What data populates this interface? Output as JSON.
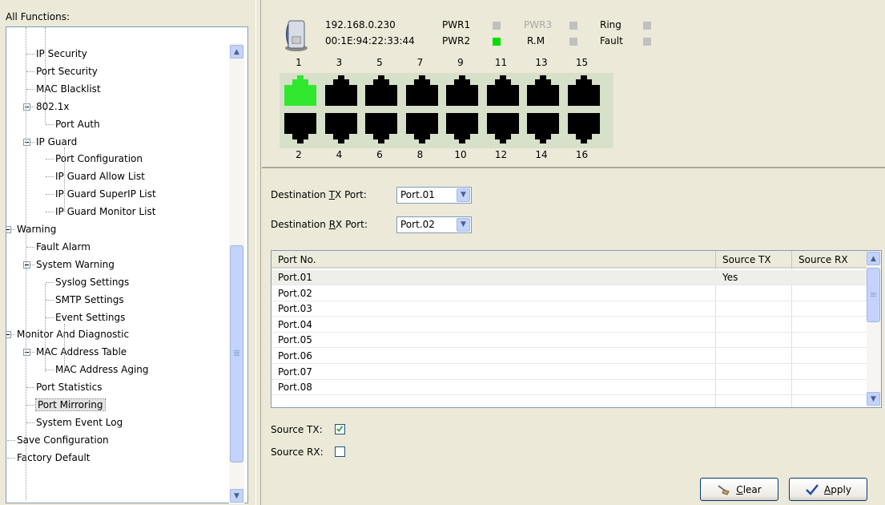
{
  "sidebar": {
    "heading": "All Functions:",
    "items": [
      {
        "label": "IP Security"
      },
      {
        "label": "Port Security"
      },
      {
        "label": "MAC Blacklist"
      },
      {
        "label": "802.1x"
      },
      {
        "label": "Port Auth"
      },
      {
        "label": "IP Guard"
      },
      {
        "label": "Port Configuration"
      },
      {
        "label": "IP Guard Allow List"
      },
      {
        "label": "IP Guard SuperIP List"
      },
      {
        "label": "IP Guard Monitor List"
      },
      {
        "label": "Warning"
      },
      {
        "label": "Fault Alarm"
      },
      {
        "label": "System Warning"
      },
      {
        "label": "Syslog Settings"
      },
      {
        "label": "SMTP Settings"
      },
      {
        "label": "Event Settings"
      },
      {
        "label": "Monitor And Diagnostic"
      },
      {
        "label": "MAC Address Table"
      },
      {
        "label": "MAC Address Aging"
      },
      {
        "label": "Port Statistics"
      },
      {
        "label": "Port Mirroring"
      },
      {
        "label": "System Event Log"
      },
      {
        "label": "Save Configuration"
      },
      {
        "label": "Factory Default"
      }
    ],
    "selected": "Port Mirroring"
  },
  "device": {
    "ip": "192.168.0.230",
    "mac": "00:1E:94:22:33:44",
    "indicators": {
      "pwr1": {
        "label": "PWR1",
        "color": "#c0c0c0"
      },
      "pwr2": {
        "label": "PWR2",
        "color": "#00e000"
      },
      "pwr3": {
        "label": "PWR3",
        "color": "#c0c0c0"
      },
      "rm": {
        "label": "R.M",
        "color": "#c0c0c0"
      },
      "ring": {
        "label": "Ring",
        "color": "#c0c0c0"
      },
      "fault": {
        "label": "Fault",
        "color": "#c0c0c0"
      }
    },
    "top_ports": [
      "1",
      "3",
      "5",
      "7",
      "9",
      "11",
      "13",
      "15"
    ],
    "bottom_ports": [
      "2",
      "4",
      "6",
      "8",
      "10",
      "12",
      "14",
      "16"
    ],
    "active_port": "1",
    "active_color": "#2fe82f",
    "idle_color": "#000000"
  },
  "config": {
    "dest_tx_label_pre": "Destination ",
    "dest_tx_label_key": "T",
    "dest_tx_label_post": "X Port:",
    "dest_tx_value": "Port.01",
    "dest_rx_label_pre": "Destination ",
    "dest_rx_label_key": "R",
    "dest_rx_label_post": "X Port:",
    "dest_rx_value": "Port.02"
  },
  "table": {
    "headers": [
      "Port No.",
      "Source TX",
      "Source RX"
    ],
    "rows": [
      [
        "Port.01",
        "Yes",
        ""
      ],
      [
        "Port.02",
        "",
        ""
      ],
      [
        "Port.03",
        "",
        ""
      ],
      [
        "Port.04",
        "",
        ""
      ],
      [
        "Port.05",
        "",
        ""
      ],
      [
        "Port.06",
        "",
        ""
      ],
      [
        "Port.07",
        "",
        ""
      ],
      [
        "Port.08",
        "",
        ""
      ]
    ]
  },
  "source": {
    "tx_label": "Source TX:",
    "tx_checked": true,
    "rx_label": "Source RX:",
    "rx_checked": false
  },
  "buttons": {
    "clear_key": "C",
    "clear_rest": "lear",
    "apply_key": "A",
    "apply_rest": "pply"
  }
}
